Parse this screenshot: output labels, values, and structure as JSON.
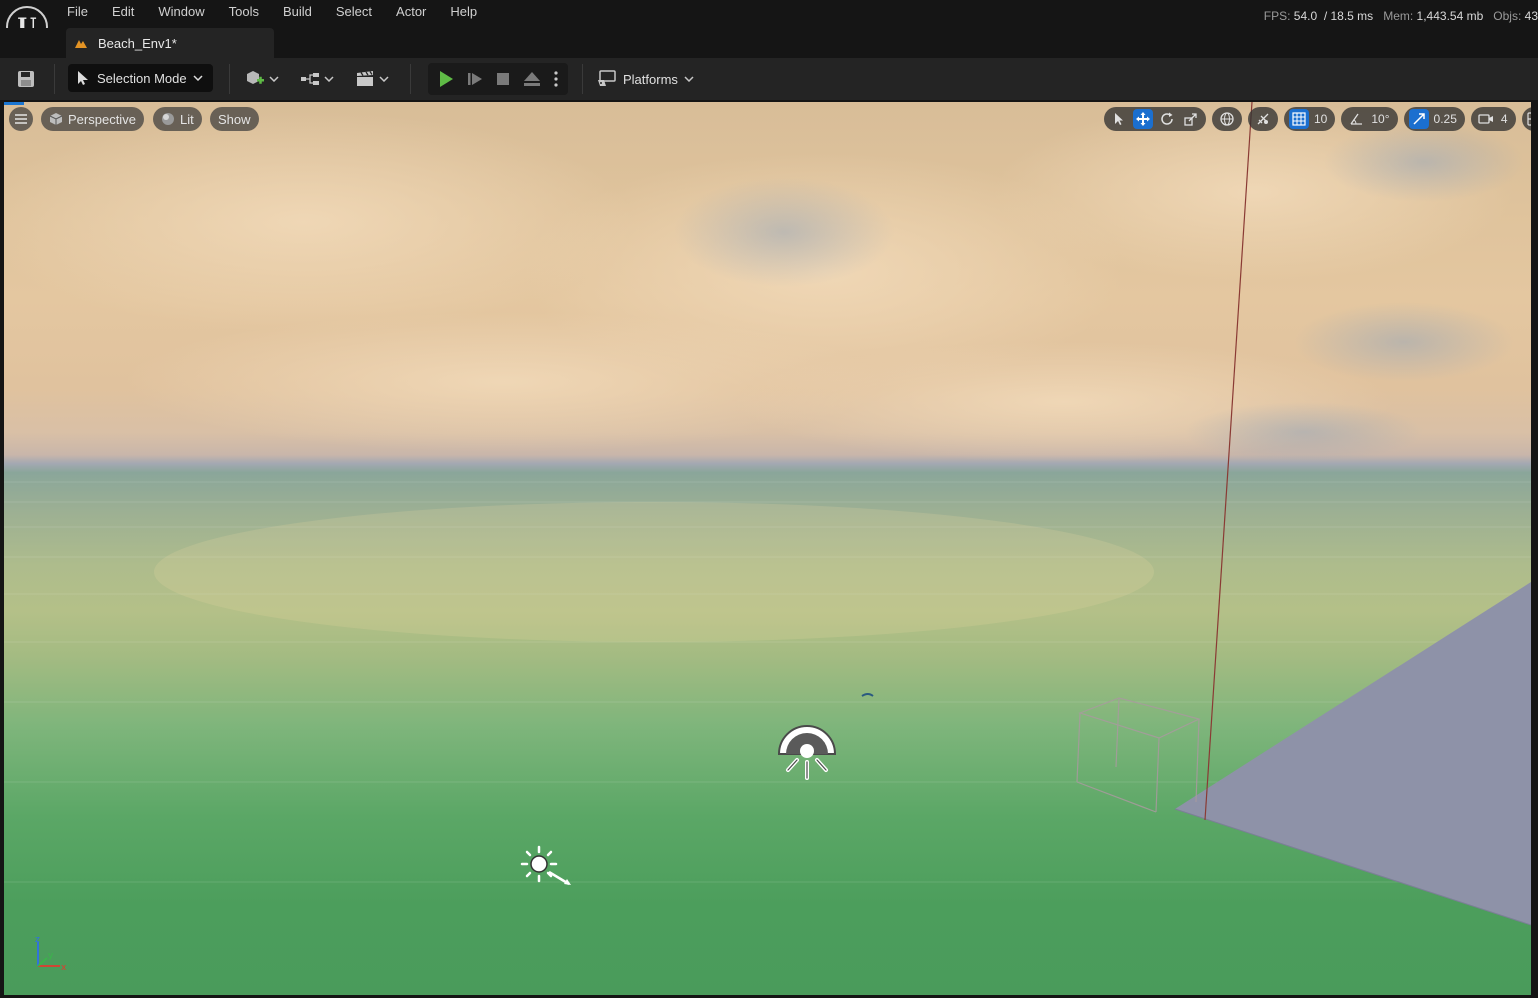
{
  "app": {
    "menu": [
      "File",
      "Edit",
      "Window",
      "Tools",
      "Build",
      "Select",
      "Actor",
      "Help"
    ],
    "stats": {
      "fps_label": "FPS:",
      "fps_value": "54.0",
      "frame_time": "/ 18.5 ms",
      "mem_label": "Mem:",
      "mem_value": "1,443.54 mb",
      "objs_label": "Objs:",
      "objs_value": "43"
    },
    "logo_letter": "U"
  },
  "document_tab": {
    "label": "Beach_Env1*",
    "icon": "level-icon",
    "icon_color": "#e39324"
  },
  "toolbar": {
    "selection_mode_label": "Selection Mode",
    "platforms_label": "Platforms",
    "play_color": "#5fbb46"
  },
  "viewport": {
    "view_mode_label": "Perspective",
    "lighting_label": "Lit",
    "show_label": "Show",
    "grid_snap_value": "10",
    "rotation_snap_value": "10°",
    "scale_snap_value": "0.25",
    "camera_speed_value": "4",
    "accent_color": "#1b6fcf"
  }
}
